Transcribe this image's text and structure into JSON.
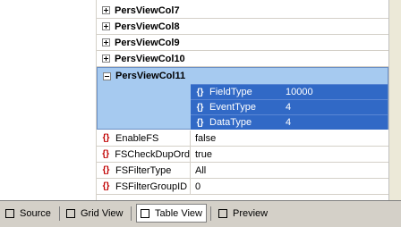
{
  "groups": [
    {
      "label": "PersViewCol7"
    },
    {
      "label": "PersViewCol8"
    },
    {
      "label": "PersViewCol9"
    },
    {
      "label": "PersViewCol10"
    }
  ],
  "expanded_group": {
    "label": "PersViewCol11",
    "fields": [
      {
        "name": "FieldType",
        "value": "10000"
      },
      {
        "name": "EventType",
        "value": "4"
      },
      {
        "name": "DataType",
        "value": "4"
      }
    ]
  },
  "properties": [
    {
      "name": "EnableFS",
      "value": "false"
    },
    {
      "name": "FSCheckDupOrd",
      "value": "true"
    },
    {
      "name": "FSFilterType",
      "value": "All"
    },
    {
      "name": "FSFilterGroupID",
      "value": "0"
    }
  ],
  "tabs": [
    {
      "label": "Source"
    },
    {
      "label": "Grid View"
    },
    {
      "label": "Table View",
      "active": true
    },
    {
      "label": "Preview"
    }
  ],
  "icons": {
    "attribute": "attribute-icon",
    "expand": "plus-box-icon",
    "collapse": "minus-box-icon"
  },
  "colors": {
    "selection": "#3169c6",
    "expanded_bg": "#a6caf0"
  }
}
